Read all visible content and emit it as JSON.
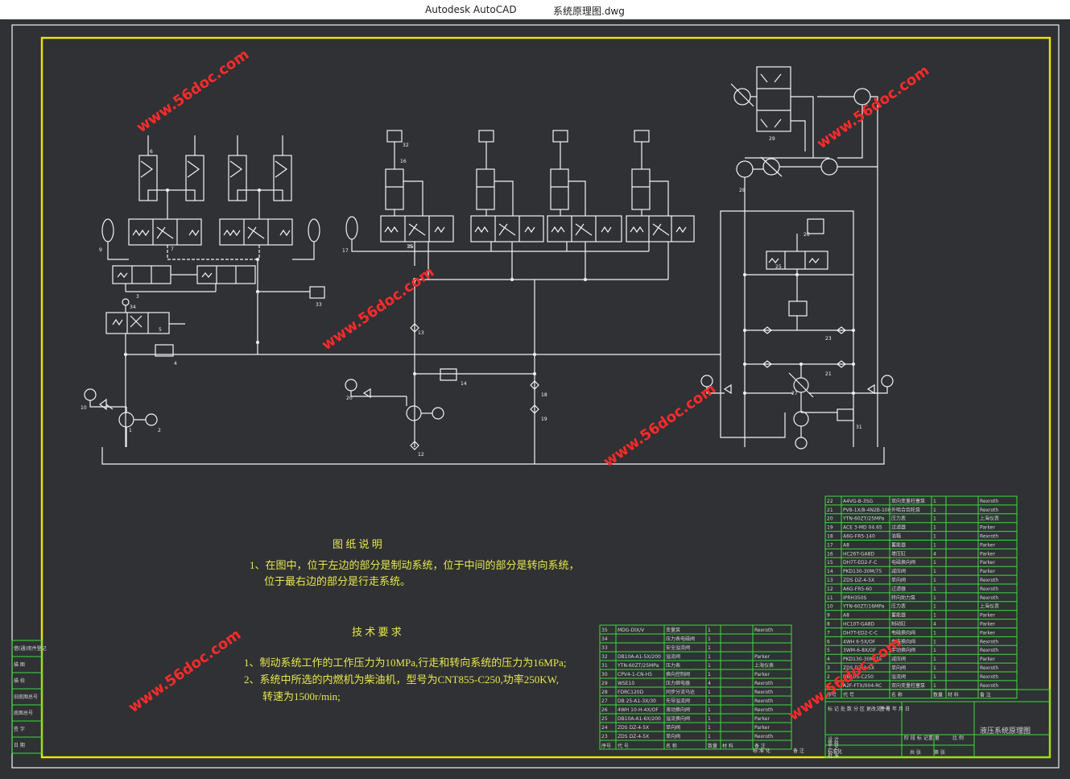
{
  "window": {
    "app_name": "Autodesk AutoCAD",
    "document": "系统原理图.dwg"
  },
  "drawing": {
    "notes_title": "图 纸 说 明",
    "notes": [
      "1、在图中，位于左边的部分是制动系统，位于中间的部分是转向系统，",
      "位于最右边的部分是行走系统。"
    ],
    "tech_title": "技 术 要 求",
    "tech": [
      "1、制动系统工作的工作压力为10MPa,行走和转向系统的压力为16MPa;",
      "2、系统中所选的内燃机为柴油机，型号为CNT855-C250,功率250KW,",
      "转速为1500r/min;"
    ],
    "title_block_name": "液压系统原理图",
    "left_stamp": [
      "借(通)用件登记",
      "描 图",
      "描 校",
      "旧底图总号",
      "底图总号",
      "签 字",
      "日 期"
    ],
    "watermark": "www.56doc.com",
    "callouts": [
      "1",
      "2",
      "3",
      "4",
      "5",
      "6",
      "7",
      "9",
      "10",
      "12",
      "13",
      "14",
      "15",
      "16",
      "17",
      "18",
      "19",
      "20",
      "21",
      "22",
      "23",
      "24",
      "25",
      "26",
      "27",
      "28",
      "29",
      "30",
      "31",
      "32",
      "33",
      "34",
      "35"
    ]
  },
  "bom_left": {
    "header": [
      "序号",
      "代 号",
      "名 称",
      "数量",
      "材 料",
      "备 注"
    ],
    "rows": [
      [
        "35",
        "MDG-DIX/V",
        "变量泵",
        "1",
        "",
        "Rexroth"
      ],
      [
        "34",
        "",
        "压力表电磁阀",
        "1",
        "",
        ""
      ],
      [
        "33",
        "",
        "安全溢流阀",
        "1",
        "",
        ""
      ],
      [
        "32",
        "DB10A-A1-5X/200",
        "溢流阀",
        "1",
        "",
        "Parker"
      ],
      [
        "31",
        "YTN-60ZT/25MPa",
        "压力表",
        "1",
        "",
        "上海仪表"
      ],
      [
        "30",
        "CPV4-1-CN-H5",
        "换向控制阀",
        "1",
        "",
        "Parker"
      ],
      [
        "29",
        "WSE10",
        "压力继电器",
        "4",
        "",
        "Rexroth"
      ],
      [
        "28",
        "FDRC120D",
        "同步分流马达",
        "1",
        "",
        "Rexroth"
      ],
      [
        "27",
        "DB 25-A1-3X/30",
        "先导溢流阀",
        "1",
        "",
        "Rexroth"
      ],
      [
        "26",
        "4WH 10-H-4X/OF",
        "液动换向阀",
        "1",
        "",
        "Rexroth"
      ],
      [
        "25",
        "DB10A-A1-6X/200",
        "溢流换向阀",
        "1",
        "",
        "Parker"
      ],
      [
        "24",
        "ZDS DZ-4-5X",
        "单向阀",
        "1",
        "",
        "Parker"
      ],
      [
        "23",
        "ZDS DZ-4-5X",
        "单向阀",
        "1",
        "",
        "Rexroth"
      ]
    ],
    "footer": [
      "标 准 化",
      "备 注"
    ]
  },
  "bom_right": {
    "header": [
      "序号",
      "代 号",
      "名 称",
      "数量",
      "材 料",
      "备 注"
    ],
    "rows": [
      [
        "22",
        "A4VG-B-3SG",
        "双向变量柱塞泵",
        "1",
        "",
        "Rexroth"
      ],
      [
        "21",
        "PV8-1X/8-4N2B-100",
        "外啮合齿轮泵",
        "1",
        "",
        "Rexroth"
      ],
      [
        "20",
        "YTN-60ZT/25MPa",
        "压力表",
        "1",
        "",
        "上海仪表"
      ],
      [
        "19",
        "ACE 3-MD 04.65",
        "过滤器",
        "1",
        "",
        "Parker"
      ],
      [
        "18",
        "A6G-FR5-140",
        "油箱",
        "1",
        "",
        "Rexroth"
      ],
      [
        "17",
        "A8",
        "蓄能器",
        "1",
        "",
        "Parker"
      ],
      [
        "16",
        "HC26T-GA8D",
        "增压缸",
        "4",
        "",
        "Parker"
      ],
      [
        "15",
        "DH7T-ED2-F-C",
        "电磁换向阀",
        "1",
        "",
        "Parker"
      ],
      [
        "14",
        "PKD130-30M/75",
        "减压阀",
        "1",
        "",
        "Parker"
      ],
      [
        "13",
        "ZDS DZ-4-5X",
        "单向阀",
        "1",
        "",
        "Rexroth"
      ],
      [
        "12",
        "A6G-FR5-60",
        "过滤器",
        "1",
        "",
        "Rexroth"
      ],
      [
        "11",
        "IPRH350S",
        "转向助力泵",
        "1",
        "",
        "Rexroth"
      ],
      [
        "10",
        "YTN-60ZT/16MPa",
        "压力表",
        "1",
        "",
        "上海仪表"
      ],
      [
        "9",
        "A8",
        "蓄能器",
        "1",
        "",
        "Parker"
      ],
      [
        "8",
        "HC10T-GA8D",
        "制动缸",
        "4",
        "",
        "Parker"
      ],
      [
        "7",
        "DH7T-ED2-C-C",
        "电磁换向阀",
        "1",
        "",
        "Parker"
      ],
      [
        "6",
        "4WH 6-5X/OF",
        "电液换向阀",
        "1",
        "",
        "Rexroth"
      ],
      [
        "5",
        "3WM-6-8X/OF",
        "手动换向阀",
        "1",
        "",
        "Rexroth"
      ],
      [
        "4",
        "PKD130-30M/75",
        "减压阀",
        "1",
        "",
        "Parker"
      ],
      [
        "3",
        "ZDS DZ-3-5X",
        "单向阀",
        "1",
        "",
        "Rexroth"
      ],
      [
        "2",
        "DB10S-C250",
        "溢流阀",
        "1",
        "",
        "Rexroth"
      ],
      [
        "1",
        "A2F-FTX/004-RC",
        "双向变量柱塞泵",
        "1",
        "",
        "Rexroth"
      ]
    ]
  },
  "title_block": {
    "labels": [
      "标 记",
      "处 数",
      "分 区",
      "更改文件号",
      "签 名",
      "年 月 日"
    ],
    "sub_labels": [
      "设 计",
      "审 核",
      "工 艺",
      "标准化",
      "批 准"
    ],
    "stage": [
      "阶 段 标 记",
      "重 量",
      "比 例"
    ],
    "sheet": [
      "共 张",
      "第 张"
    ]
  },
  "colors": {
    "background": "#2f3134",
    "frame": "#f2f2f2",
    "border": "#e8e800",
    "table": "#3ddc3d",
    "notes": "#e8e84a",
    "watermark": "#ff2a2a"
  }
}
